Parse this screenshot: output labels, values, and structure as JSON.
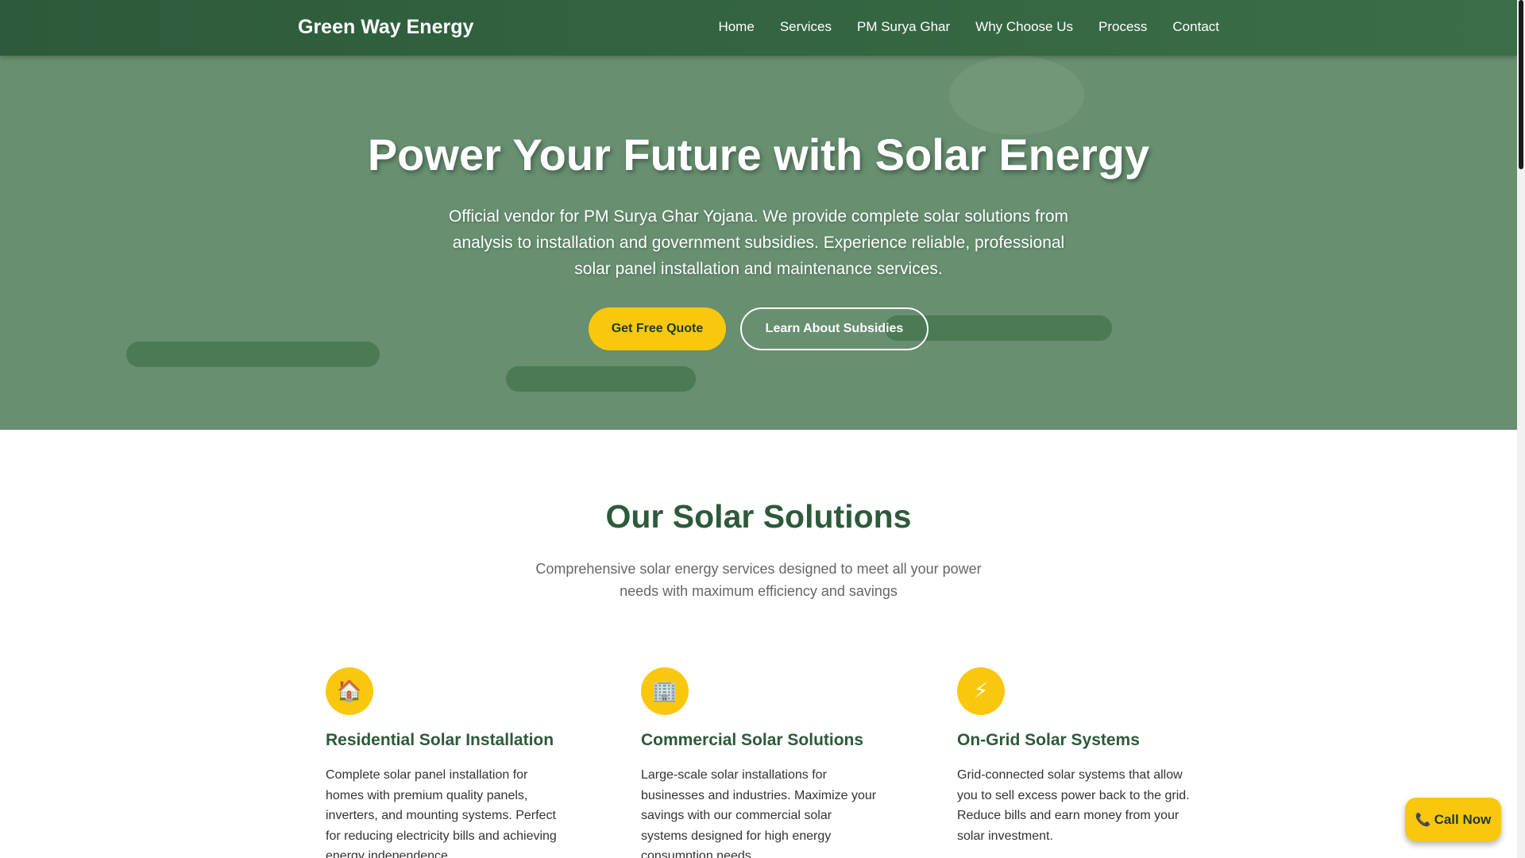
{
  "header": {
    "logo": "Green Way Energy",
    "nav": [
      "Home",
      "Services",
      "PM Surya Ghar",
      "Why Choose Us",
      "Process",
      "Contact"
    ]
  },
  "hero": {
    "title": "Power Your Future with Solar Energy",
    "text": "Official vendor for PM Surya Ghar Yojana. We provide complete solar solutions from analysis to installation and government subsidies. Experience reliable, professional solar panel installation and maintenance services.",
    "primary_button": "Get Free Quote",
    "secondary_button": "Learn About Subsidies"
  },
  "solutions": {
    "title": "Our Solar Solutions",
    "subtitle": "Comprehensive solar energy services designed to meet all your power needs with maximum efficiency and savings",
    "cards": [
      {
        "icon": "house-icon",
        "glyph": "🏠",
        "title": "Residential Solar Installation",
        "description": "Complete solar panel installation for homes with premium quality panels, inverters, and mounting systems. Perfect for reducing electricity bills and achieving energy independence."
      },
      {
        "icon": "office-building-icon",
        "glyph": "🏢",
        "title": "Commercial Solar Solutions",
        "description": "Large-scale solar installations for businesses and industries. Maximize your savings with our commercial solar systems designed for high energy consumption needs."
      },
      {
        "icon": "lightning-icon",
        "glyph": "⚡",
        "title": "On-Grid Solar Systems",
        "description": "Grid-connected solar systems that allow you to sell excess power back to the grid. Reduce bills and earn money from your solar investment."
      }
    ]
  },
  "call_button": {
    "icon": "phone-icon",
    "glyph": "📞",
    "label": "Call Now"
  },
  "colors": {
    "primary_green": "#2d5a3a",
    "hero_green": "#678f70",
    "accent_yellow": "#f9c80e"
  }
}
